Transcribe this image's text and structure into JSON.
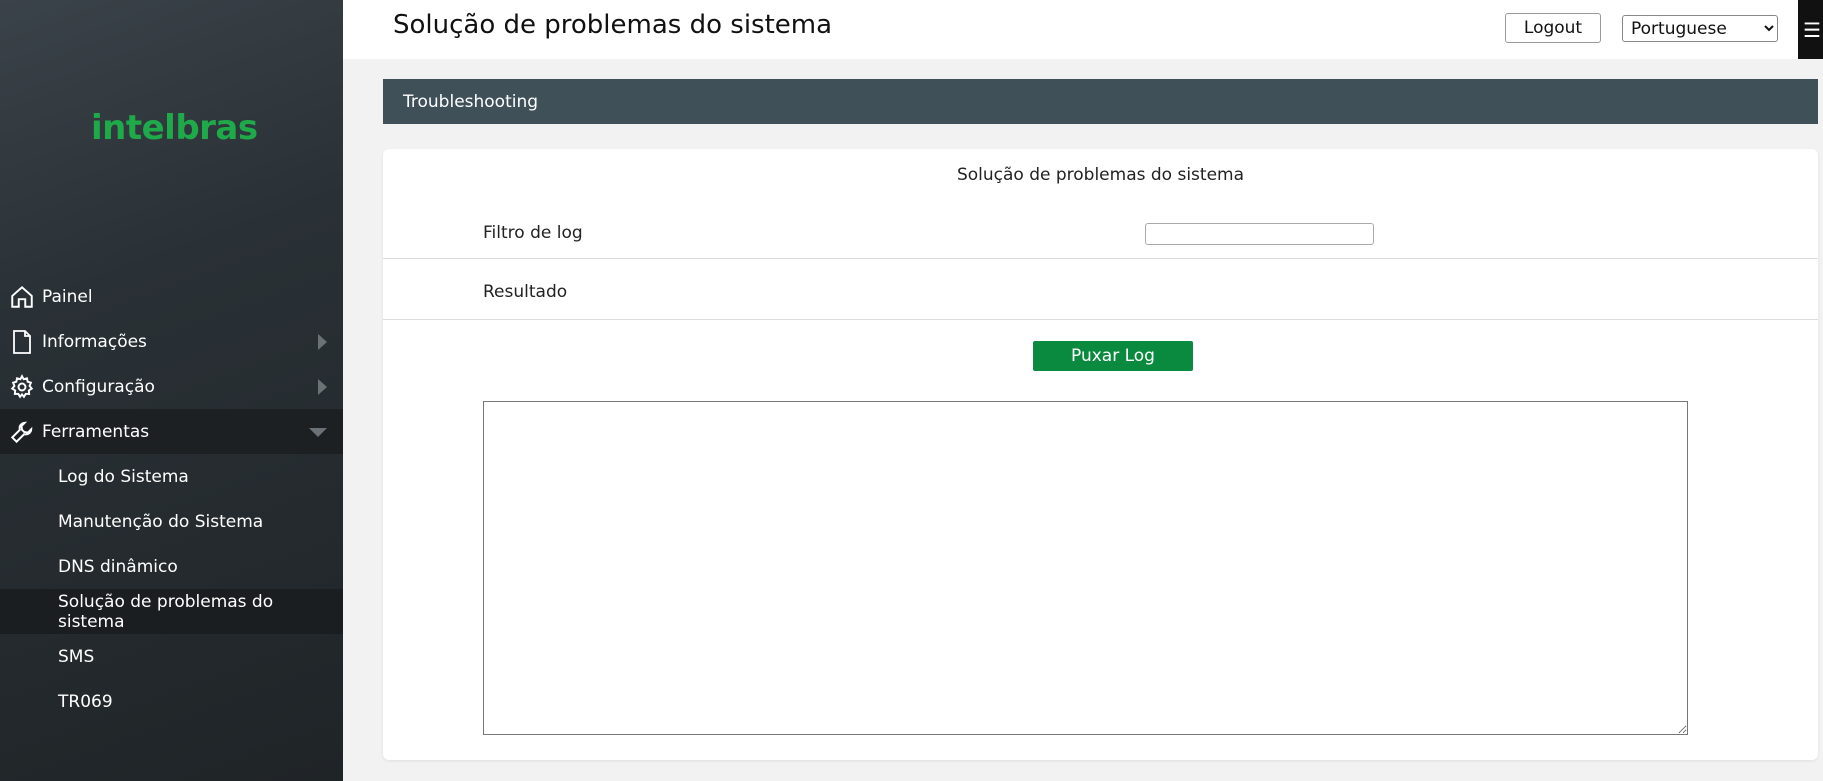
{
  "brand": {
    "logo_text": "intelbras",
    "accent_color": "#1faa4a"
  },
  "header": {
    "title": "Solução de problemas do sistema",
    "logout_label": "Logout",
    "language_selected": "Portuguese"
  },
  "sidebar": {
    "items": [
      {
        "label": "Painel",
        "icon": "home-icon"
      },
      {
        "label": "Informações",
        "icon": "document-icon"
      },
      {
        "label": "Configuração",
        "icon": "gear-icon"
      },
      {
        "label": "Ferramentas",
        "icon": "wrench-icon"
      }
    ],
    "subitems": [
      {
        "label": "Log do Sistema"
      },
      {
        "label": "Manutenção do Sistema"
      },
      {
        "label": "DNS dinâmico"
      },
      {
        "label": "Solução de problemas do sistema"
      },
      {
        "label": "SMS"
      },
      {
        "label": "TR069"
      }
    ]
  },
  "section": {
    "header": "Troubleshooting"
  },
  "panel": {
    "title": "Solução de problemas do sistema",
    "filter_label": "Filtro de log",
    "filter_value": "",
    "result_label": "Resultado",
    "pull_button": "Puxar Log",
    "log_content": ""
  },
  "colors": {
    "section_header_bg": "#3f5058",
    "primary_button": "#0a8a3e"
  }
}
